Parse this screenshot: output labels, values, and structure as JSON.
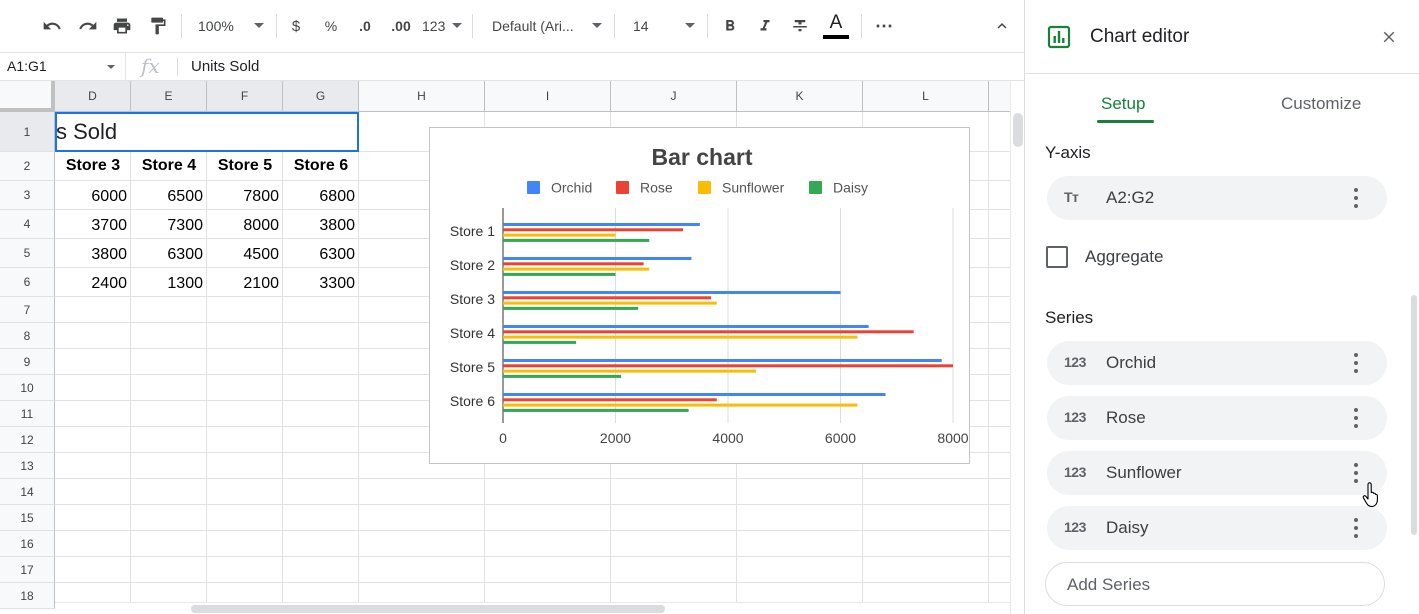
{
  "toolbar": {
    "zoom": "100%",
    "currency": "$",
    "percent": "%",
    "decrease_decimals": ".0",
    "increase_decimals": ".00",
    "number_format": "123",
    "font_family": "Default (Ari...",
    "font_size": "14",
    "text_color_letter": "A",
    "more": "⋯"
  },
  "formula_bar": {
    "name_box": "A1:G1",
    "fx": "fx",
    "value": "Units Sold"
  },
  "grid": {
    "columns": [
      "D",
      "E",
      "F",
      "G",
      "H",
      "I",
      "J",
      "K",
      "L"
    ],
    "rows": [
      "1",
      "2",
      "3",
      "4",
      "5",
      "6",
      "7",
      "8",
      "9",
      "10",
      "11",
      "12",
      "13",
      "14",
      "15",
      "16",
      "17",
      "18"
    ],
    "title_cell": "s Sold",
    "header_row": [
      "Store 3",
      "Store 4",
      "Store 5",
      "Store 6"
    ],
    "data_rows": [
      [
        "6000",
        "6500",
        "7800",
        "6800"
      ],
      [
        "3700",
        "7300",
        "8000",
        "3800"
      ],
      [
        "3800",
        "6300",
        "4500",
        "6300"
      ],
      [
        "2400",
        "1300",
        "2100",
        "3300"
      ]
    ]
  },
  "chart_data": {
    "type": "bar",
    "orientation": "horizontal",
    "title": "Bar chart",
    "categories": [
      "Store 1",
      "Store 2",
      "Store 3",
      "Store 4",
      "Store 5",
      "Store 6"
    ],
    "series": [
      {
        "name": "Orchid",
        "color": "#4285f4",
        "values": [
          3500,
          3350,
          6000,
          6500,
          7800,
          6800
        ]
      },
      {
        "name": "Rose",
        "color": "#ea4335",
        "values": [
          3200,
          2500,
          3700,
          7300,
          8000,
          3800
        ]
      },
      {
        "name": "Sunflower",
        "color": "#fbbc04",
        "values": [
          2000,
          2600,
          3800,
          6300,
          4500,
          6300
        ]
      },
      {
        "name": "Daisy",
        "color": "#34a853",
        "values": [
          2600,
          2000,
          2400,
          1300,
          2100,
          3300
        ]
      }
    ],
    "xlim": [
      0,
      8000
    ],
    "x_ticks": [
      "0",
      "2000",
      "4000",
      "6000",
      "8000"
    ],
    "grid": true,
    "legend": "top"
  },
  "editor": {
    "title": "Chart editor",
    "tabs": [
      "Setup",
      "Customize"
    ],
    "y_axis_title": "Y-axis",
    "y_axis_chip": {
      "icon": "Tт",
      "label": "A2:G2"
    },
    "aggregate_label": "Aggregate",
    "series_title": "Series",
    "series_chips": [
      {
        "icon": "123",
        "label": "Orchid"
      },
      {
        "icon": "123",
        "label": "Rose"
      },
      {
        "icon": "123",
        "label": "Sunflower"
      },
      {
        "icon": "123",
        "label": "Daisy"
      }
    ],
    "add_series": "Add Series"
  }
}
